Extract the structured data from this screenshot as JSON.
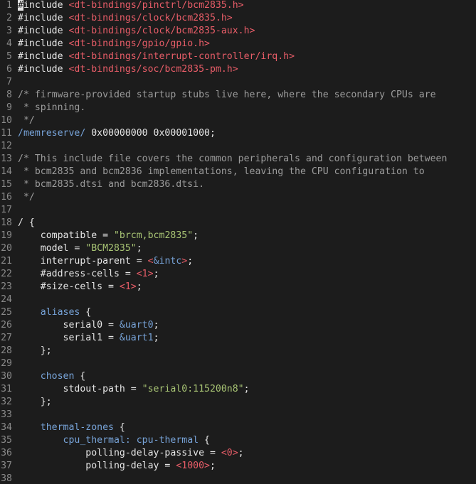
{
  "editor": {
    "colors": {
      "background": "#1c1c1c",
      "line_number": "#8a8a8a",
      "text": "#e6e6e6",
      "include_path": "#e85d68",
      "comment": "#9c9c9c",
      "keyword": "#77a3d8",
      "number": "#e85d68",
      "string": "#a8c474"
    },
    "lines": [
      {
        "num": "1",
        "tokens": [
          {
            "t": "cursor",
            "v": "#"
          },
          {
            "t": "normal",
            "v": "include "
          },
          {
            "t": "string",
            "v": "<dt-bindings/pinctrl/bcm2835.h>"
          }
        ]
      },
      {
        "num": "2",
        "tokens": [
          {
            "t": "normal",
            "v": "#include "
          },
          {
            "t": "string",
            "v": "<dt-bindings/clock/bcm2835.h>"
          }
        ]
      },
      {
        "num": "3",
        "tokens": [
          {
            "t": "normal",
            "v": "#include "
          },
          {
            "t": "string",
            "v": "<dt-bindings/clock/bcm2835-aux.h>"
          }
        ]
      },
      {
        "num": "4",
        "tokens": [
          {
            "t": "normal",
            "v": "#include "
          },
          {
            "t": "string",
            "v": "<dt-bindings/gpio/gpio.h>"
          }
        ]
      },
      {
        "num": "5",
        "tokens": [
          {
            "t": "normal",
            "v": "#include "
          },
          {
            "t": "string",
            "v": "<dt-bindings/interrupt-controller/irq.h>"
          }
        ]
      },
      {
        "num": "6",
        "tokens": [
          {
            "t": "normal",
            "v": "#include "
          },
          {
            "t": "string",
            "v": "<dt-bindings/soc/bcm2835-pm.h>"
          }
        ]
      },
      {
        "num": "7",
        "tokens": []
      },
      {
        "num": "8",
        "tokens": [
          {
            "t": "comment",
            "v": "/* firmware-provided startup stubs live here, where the secondary CPUs are"
          }
        ]
      },
      {
        "num": "9",
        "tokens": [
          {
            "t": "comment",
            "v": " * spinning."
          }
        ]
      },
      {
        "num": "10",
        "tokens": [
          {
            "t": "comment",
            "v": " */"
          }
        ]
      },
      {
        "num": "11",
        "tokens": [
          {
            "t": "keyword",
            "v": "/memreserve/"
          },
          {
            "t": "normal",
            "v": " 0x00000000 0x00001000;"
          }
        ]
      },
      {
        "num": "12",
        "tokens": []
      },
      {
        "num": "13",
        "tokens": [
          {
            "t": "comment",
            "v": "/* This include file covers the common peripherals and configuration between"
          }
        ]
      },
      {
        "num": "14",
        "tokens": [
          {
            "t": "comment",
            "v": " * bcm2835 and bcm2836 implementations, leaving the CPU configuration to"
          }
        ]
      },
      {
        "num": "15",
        "tokens": [
          {
            "t": "comment",
            "v": " * bcm2835.dtsi and bcm2836.dtsi."
          }
        ]
      },
      {
        "num": "16",
        "tokens": [
          {
            "t": "comment",
            "v": " */"
          }
        ]
      },
      {
        "num": "17",
        "tokens": []
      },
      {
        "num": "18",
        "tokens": [
          {
            "t": "normal",
            "v": "/ {"
          }
        ]
      },
      {
        "num": "19",
        "tokens": [
          {
            "t": "normal",
            "v": "    compatible = "
          },
          {
            "t": "strval",
            "v": "\"brcm,bcm2835\""
          },
          {
            "t": "normal",
            "v": ";"
          }
        ]
      },
      {
        "num": "20",
        "tokens": [
          {
            "t": "normal",
            "v": "    model = "
          },
          {
            "t": "strval",
            "v": "\"BCM2835\""
          },
          {
            "t": "normal",
            "v": ";"
          }
        ]
      },
      {
        "num": "21",
        "tokens": [
          {
            "t": "normal",
            "v": "    interrupt-parent = "
          },
          {
            "t": "number",
            "v": "<"
          },
          {
            "t": "ref",
            "v": "&intc"
          },
          {
            "t": "number",
            "v": ">"
          },
          {
            "t": "normal",
            "v": ";"
          }
        ]
      },
      {
        "num": "22",
        "tokens": [
          {
            "t": "normal",
            "v": "    #address-cells = "
          },
          {
            "t": "number",
            "v": "<1>"
          },
          {
            "t": "normal",
            "v": ";"
          }
        ]
      },
      {
        "num": "23",
        "tokens": [
          {
            "t": "normal",
            "v": "    #size-cells = "
          },
          {
            "t": "number",
            "v": "<1>"
          },
          {
            "t": "normal",
            "v": ";"
          }
        ]
      },
      {
        "num": "24",
        "tokens": []
      },
      {
        "num": "25",
        "tokens": [
          {
            "t": "normal",
            "v": "    "
          },
          {
            "t": "keyword",
            "v": "aliases"
          },
          {
            "t": "normal",
            "v": " {"
          }
        ]
      },
      {
        "num": "26",
        "tokens": [
          {
            "t": "normal",
            "v": "        serial0 = "
          },
          {
            "t": "ref",
            "v": "&uart0"
          },
          {
            "t": "normal",
            "v": ";"
          }
        ]
      },
      {
        "num": "27",
        "tokens": [
          {
            "t": "normal",
            "v": "        serial1 = "
          },
          {
            "t": "ref",
            "v": "&uart1"
          },
          {
            "t": "normal",
            "v": ";"
          }
        ]
      },
      {
        "num": "28",
        "tokens": [
          {
            "t": "normal",
            "v": "    };"
          }
        ]
      },
      {
        "num": "29",
        "tokens": []
      },
      {
        "num": "30",
        "tokens": [
          {
            "t": "normal",
            "v": "    "
          },
          {
            "t": "keyword",
            "v": "chosen"
          },
          {
            "t": "normal",
            "v": " {"
          }
        ]
      },
      {
        "num": "31",
        "tokens": [
          {
            "t": "normal",
            "v": "        stdout-path = "
          },
          {
            "t": "strval",
            "v": "\"serial0:115200n8\""
          },
          {
            "t": "normal",
            "v": ";"
          }
        ]
      },
      {
        "num": "32",
        "tokens": [
          {
            "t": "normal",
            "v": "    };"
          }
        ]
      },
      {
        "num": "33",
        "tokens": []
      },
      {
        "num": "34",
        "tokens": [
          {
            "t": "normal",
            "v": "    "
          },
          {
            "t": "keyword",
            "v": "thermal-zones"
          },
          {
            "t": "normal",
            "v": " {"
          }
        ]
      },
      {
        "num": "35",
        "tokens": [
          {
            "t": "normal",
            "v": "        "
          },
          {
            "t": "label",
            "v": "cpu_thermal: cpu-thermal"
          },
          {
            "t": "normal",
            "v": " {"
          }
        ]
      },
      {
        "num": "36",
        "tokens": [
          {
            "t": "normal",
            "v": "            polling-delay-passive = "
          },
          {
            "t": "number",
            "v": "<0>"
          },
          {
            "t": "normal",
            "v": ";"
          }
        ]
      },
      {
        "num": "37",
        "tokens": [
          {
            "t": "normal",
            "v": "            polling-delay = "
          },
          {
            "t": "number",
            "v": "<1000>"
          },
          {
            "t": "normal",
            "v": ";"
          }
        ]
      },
      {
        "num": "38",
        "tokens": []
      }
    ]
  }
}
